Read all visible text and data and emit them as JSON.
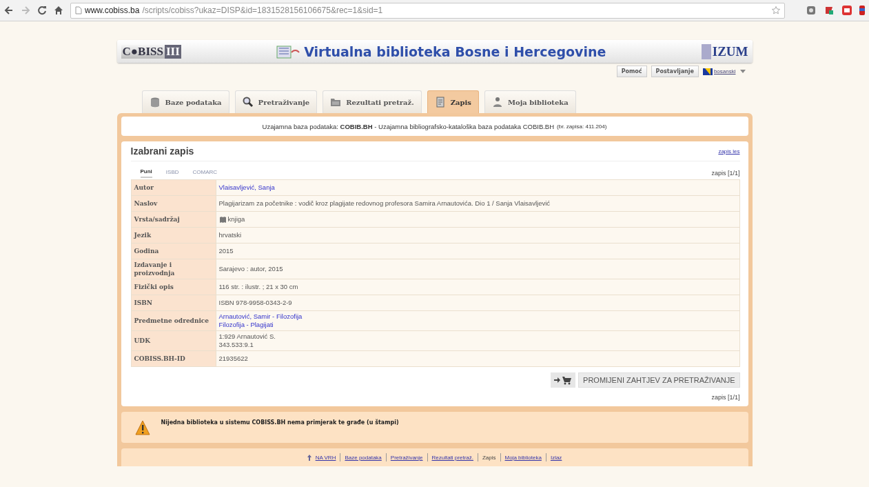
{
  "browser": {
    "url_host": "www.cobiss.ba",
    "url_path": "/scripts/cobiss?ukaz=DISP&id=1831528156106675&rec=1&sid=1"
  },
  "header": {
    "logo_left": "C●BISS",
    "logo_left_tail": "III",
    "title": "Virtualna biblioteka Bosne i Hercegovine",
    "logo_right": "IZUM",
    "links": [
      "Pomoć",
      "Postavljanje"
    ],
    "language": "bosanski"
  },
  "tabs": [
    {
      "label": "Baze podataka",
      "selected": false
    },
    {
      "label": "Pretraživanje",
      "selected": false
    },
    {
      "label": "Rezultati pretraž.",
      "selected": false
    },
    {
      "label": "Zapis",
      "selected": true
    },
    {
      "label": "Moja biblioteka",
      "selected": false
    }
  ],
  "info": {
    "text": "Uzajamna baza podataka: **COBIB.BH** - Uzajamna bibliografsko-kataloška baza podataka COBIB.BH",
    "count": "(br. zapisa: 411.204)"
  },
  "record": {
    "title": "Izabrani zapis",
    "top_link": "zapis les",
    "format_tabs": [
      {
        "label": "Puni",
        "selected": true
      },
      {
        "label": "ISBD",
        "selected": false
      },
      {
        "label": "COMARC",
        "selected": false
      }
    ],
    "counter": "zapis [1/1]",
    "rows": [
      {
        "label": "Autor",
        "values": [
          "Vlaisavljević, Sanja"
        ],
        "kind": "link"
      },
      {
        "label": "Naslov",
        "values": [
          "Plagijarizam za početnike : vodič kroz plagijate redovnog profesora Samira Arnautovića. Dio 1 / Sanja Vlaisavljević"
        ],
        "kind": "text"
      },
      {
        "label": "Vrsta/sadržaj",
        "values": [
          "knjiga"
        ],
        "kind": "book"
      },
      {
        "label": "Jezik",
        "values": [
          "hrvatski"
        ],
        "kind": "text"
      },
      {
        "label": "Godina",
        "values": [
          "2015"
        ],
        "kind": "text"
      },
      {
        "label": "Izdavanje i proizvodnja",
        "values": [
          "Sarajevo : autor, 2015"
        ],
        "kind": "text"
      },
      {
        "label": "Fizički opis",
        "values": [
          "116 str. : ilustr. ; 21 x 30 cm"
        ],
        "kind": "text"
      },
      {
        "label": "ISBN",
        "values": [
          "ISBN 978-9958-0343-2-9"
        ],
        "kind": "text"
      },
      {
        "label": "Predmetne odrednice",
        "values": [
          "Arnautović, Samir - Filozofija",
          "Filozofija - Plagijati"
        ],
        "kind": "link"
      },
      {
        "label": "UDK",
        "values": [
          "1:929 Arnautović S.",
          "343.533:9.1"
        ],
        "kind": "text"
      },
      {
        "label": "COBISS.BH-ID",
        "values": [
          "21935622"
        ],
        "kind": "text"
      }
    ],
    "action_button": "PROMIJENI ZAHTJEV ZA PRETRAŽIVANJE",
    "counter_bottom": "zapis [1/1]"
  },
  "warning": "Nijedna biblioteka u sistemu COBISS.BH nema primjerak te građe (u štampi)",
  "footer": [
    {
      "label": "NA VRH",
      "link": true
    },
    {
      "label": "Baze podataka",
      "link": true
    },
    {
      "label": "Pretraživanje",
      "link": true
    },
    {
      "label": "Rezultati pretraž.",
      "link": true
    },
    {
      "label": "Zapis",
      "link": false
    },
    {
      "label": "Moja biblioteka",
      "link": true
    },
    {
      "label": "Izlaz",
      "link": true
    }
  ]
}
